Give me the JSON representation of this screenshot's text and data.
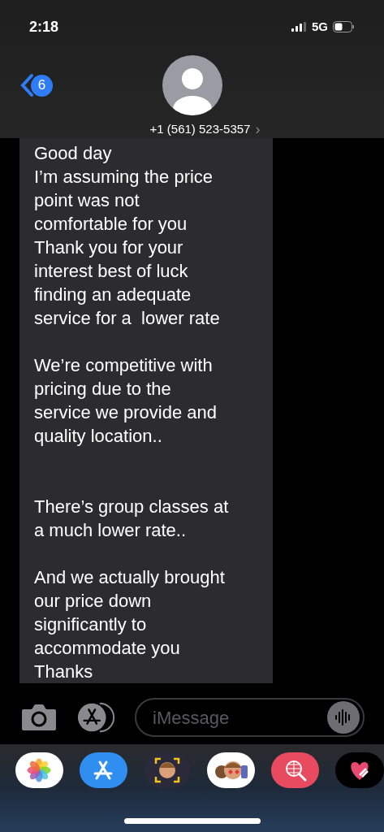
{
  "status_bar": {
    "time": "2:18",
    "network": "5G"
  },
  "header": {
    "back_badge": "6",
    "contact": "+1 (561) 523-5357",
    "chevron": "›"
  },
  "messages": [
    {
      "kind": "received",
      "text": "Good day\nI’m assuming the price\npoint was not\ncomfortable for you\nThank you for your\ninterest best of luck\nfinding an adequate\nservice for a  lower rate\n\nWe’re competitive with\npricing due to the\nservice we provide and\nquality location..\n\n\nThere’s group classes at\na much lower rate..\n\nAnd we actually brought\nour price down\nsignificantly to\naccommodate you\nThanks"
    }
  ],
  "composer": {
    "placeholder": "iMessage"
  },
  "app_tray": [
    {
      "kind": "photos"
    },
    {
      "kind": "store"
    },
    {
      "kind": "memoji"
    },
    {
      "kind": "stickers"
    },
    {
      "kind": "search"
    },
    {
      "kind": "heart"
    }
  ]
}
